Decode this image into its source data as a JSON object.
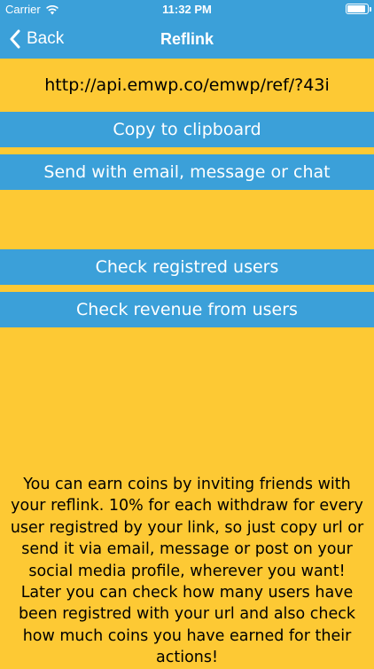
{
  "status_bar": {
    "carrier": "Carrier",
    "time": "11:32 PM"
  },
  "nav": {
    "back_label": "Back",
    "title": "Reflink"
  },
  "reflink": {
    "url": "http://api.emwp.co/emwp/ref/?43i"
  },
  "buttons": {
    "copy": "Copy to clipboard",
    "send": "Send with email, message or chat",
    "check_users": "Check registred users",
    "check_revenue": "Check revenue from users"
  },
  "info_text": "You can earn coins by inviting friends with your reflink. 10% for each withdraw for every user registred by your link, so just copy url or send it via email, message or post on your social media profile, wherever you want! Later you can check how many users have been registred with your url and also check how much coins you have earned for their actions!",
  "colors": {
    "accent": "#3BA0D9",
    "background": "#FDC934"
  },
  "icons": [
    "wifi-icon",
    "battery-icon",
    "chevron-left-icon"
  ]
}
